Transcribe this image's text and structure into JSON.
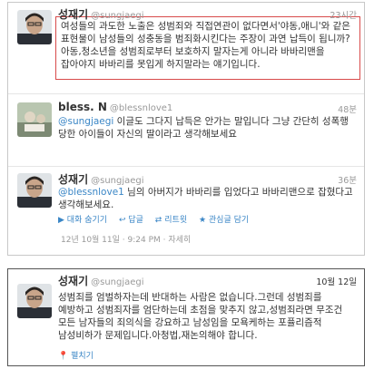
{
  "tweets": [
    {
      "name": "성재기",
      "handle": "@sungjaegi",
      "time": "23시간",
      "text": "여성들의 과도한 노출은 성범죄와 직접연관이 없다면서'야동,애니'와 같은 표현물이 남성들의 성충동을 범죄화시킨다는 주장이 과연 납득이 됩니까?아동,청소년을 성범죄로부터 보호하지 말자는게 아니라 바바리맨을 잡아야지 바바리를 못입게 하지말라는 얘기입니다."
    },
    {
      "name": "bless. N",
      "handle": "@blessnlove1",
      "time": "48분",
      "mention": "@sungjaegi",
      "text": " 이글도 그다지 납득은 안가는 말입니다 그냥 간단히 성폭행 당한 아이들이 자신의 딸이라고 생각해보세요"
    },
    {
      "name": "성재기",
      "handle": "@sungjaegi",
      "time": "36분",
      "mention": "@blessnlove1",
      "text": " 님의 아버지가 바바리를 입었다고 바바리맨으로 잡혔다고 생각해보세요.",
      "actions": {
        "collapse": "대화 숨기기",
        "reply": "답글",
        "retweet": "리트윗",
        "favorite": "관심글 담기"
      },
      "meta": "12년 10월 11일 · 9:24 PM · 자세히"
    }
  ],
  "single_tweet": {
    "name": "성재기",
    "handle": "@sungjaegi",
    "time": "10월 12일",
    "text": "성범죄를 엄벌하자는데 반대하는 사람은 없습니다.그런데 성범죄를 예방하고 성범죄자를 엄단하는데 초점을 맞추지 않고,성범죄라면 무조건 모든 남자들의 죄의식을 강요하고 남성임을 모욕케하는 포퓰리즘적 남성비하가 문제입니다.아청법,재논의해야 합니다.",
    "place": "펼치기"
  },
  "colors": {
    "link": "#3a86c6",
    "highlight_border": "#d84a4a",
    "muted": "#999999"
  }
}
